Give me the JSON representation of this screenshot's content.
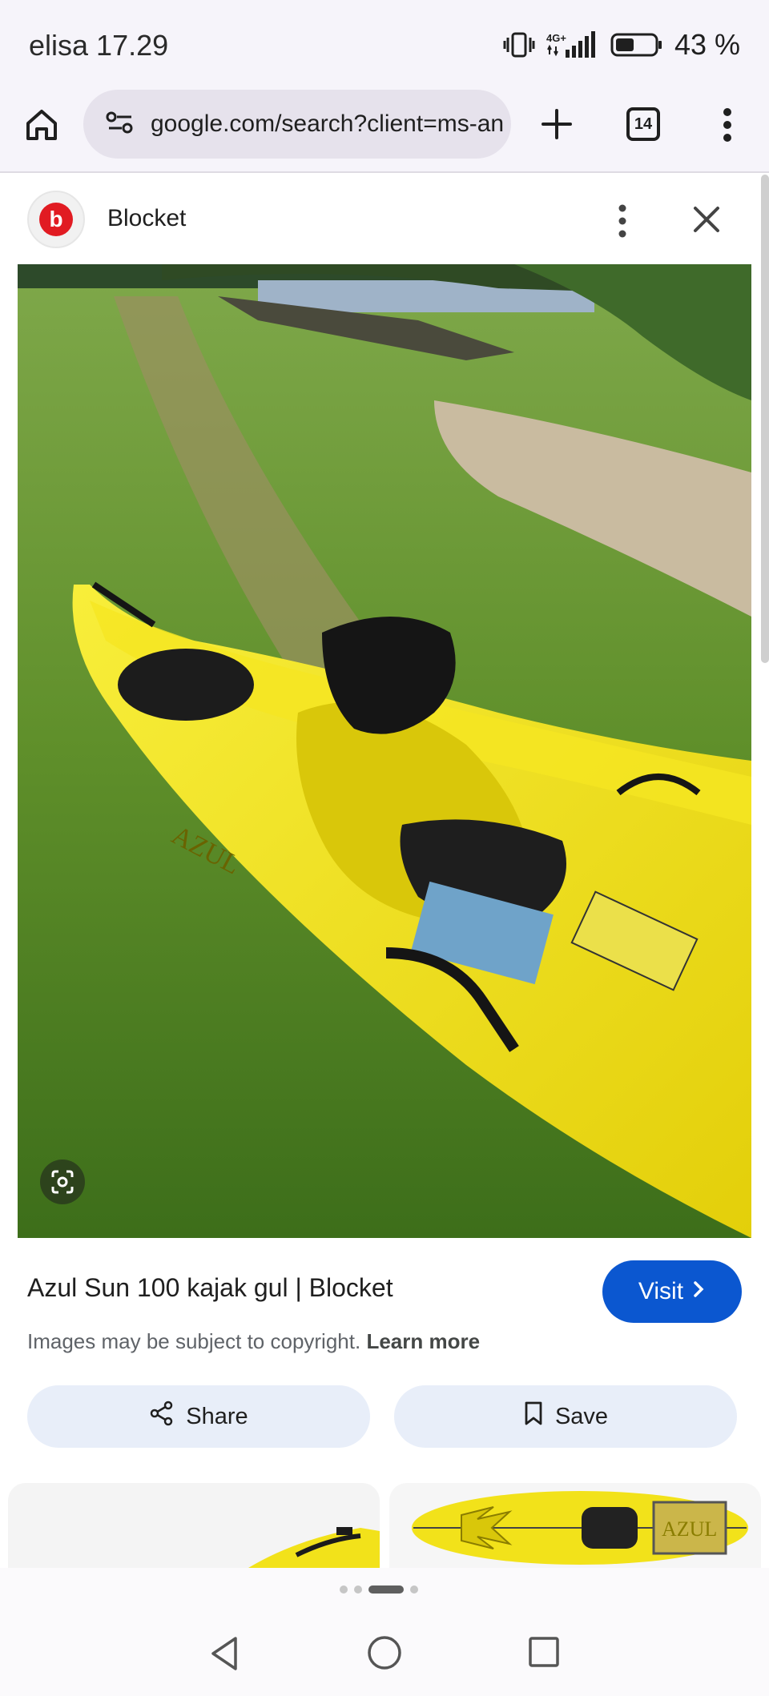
{
  "status_bar": {
    "carrier_time": "elisa 17.29",
    "network": "4G+",
    "battery": "43 %"
  },
  "browser": {
    "url": "google.com/search?client=ms-an",
    "tab_count": "14"
  },
  "card": {
    "site_name": "Blocket",
    "favicon_letter": "b",
    "brand_color": "#e11b22"
  },
  "result": {
    "title": "Azul Sun 100 kajak gul | Blocket",
    "visit_label": "Visit",
    "copyright_text": "Images may be subject to copyright.",
    "learn_more": "Learn more",
    "share_label": "Share",
    "save_label": "Save"
  },
  "colors": {
    "visit_button": "#0b57d0",
    "action_button_bg": "#e8eef9",
    "kayak_yellow": "#f2e21a"
  },
  "icons": {
    "home": "home-icon",
    "site_info": "tune-icon",
    "new_tab": "plus-icon",
    "tabs": "tab-switcher-icon",
    "menu": "more-vert-icon",
    "lens": "google-lens-icon",
    "share": "share-icon",
    "save": "bookmark-icon",
    "nav_back": "back-triangle-icon",
    "nav_home": "home-circle-icon",
    "nav_recent": "recent-square-icon"
  },
  "thumbnail_kayak_brand": "AZUL"
}
